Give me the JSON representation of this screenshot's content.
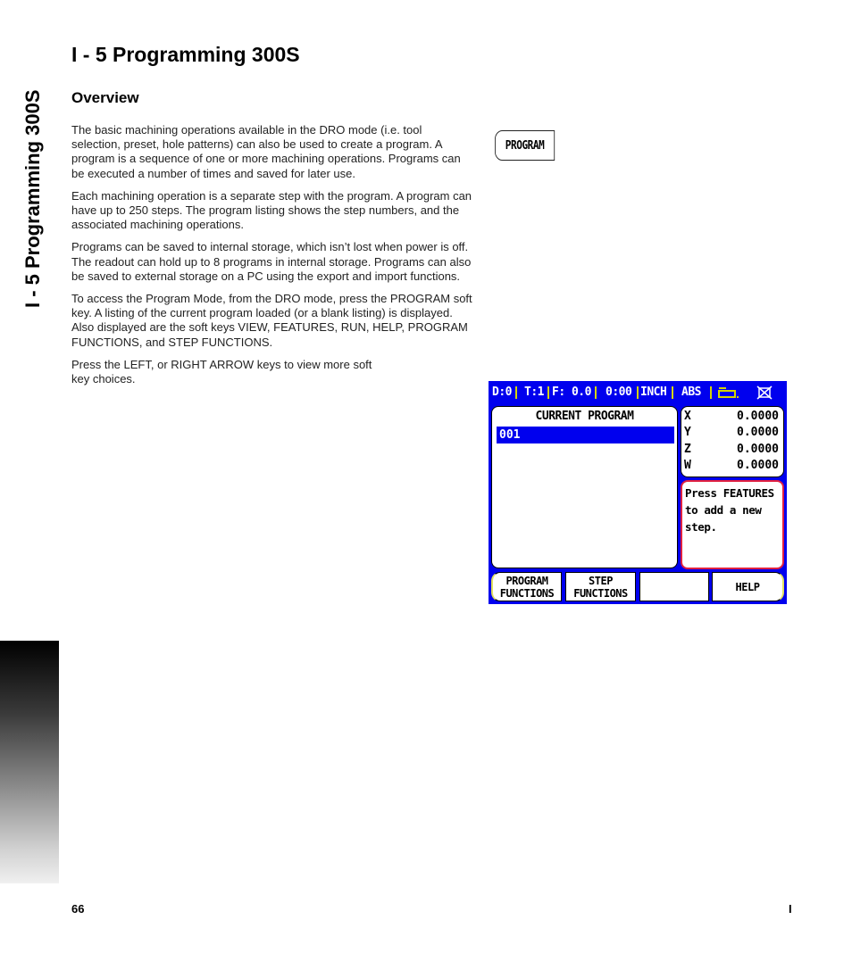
{
  "side_tab": {
    "label": "I - 5 Programming 300S"
  },
  "header": {
    "title": "I - 5 Programming 300S",
    "section": "Overview"
  },
  "body": {
    "paragraphs": [
      "The basic machining operations available in the DRO mode (i.e. tool selection, preset, hole patterns) can also be used to create a program. A program is a sequence of one or more machining operations. Programs can be executed a number of times and saved for later use.",
      "Each machining operation is a separate step with the program.  A program can have up to 250 steps.  The program listing shows the step numbers, and the associated machining operations.",
      "Programs can be saved to internal storage, which isn’t lost when power is off.  The readout can hold up to 8 programs in internal storage.  Programs can also be saved to external storage on a PC using the export and import functions.",
      "To access the Program Mode, from the DRO mode,  press the PROGRAM soft key.  A listing of the current program loaded (or a blank listing) is displayed.  Also displayed are the soft keys VIEW, FEATURES, RUN, HELP, PROGRAM FUNCTIONS, and STEP FUNCTIONS.",
      "Press the LEFT, or RIGHT ARROW keys to view more soft key choices."
    ]
  },
  "program_key": {
    "label": "PROGRAM"
  },
  "dro_screen": {
    "status_bar": {
      "datum": "D:0",
      "tool": "T:1",
      "feed": "F:  0.0",
      "timer": "0:00",
      "units": "INCH",
      "mode": "ABS",
      "icons": [
        "tool-holder-icon",
        "disabled-indicator-icon"
      ]
    },
    "program_panel": {
      "header": "CURRENT PROGRAM",
      "rows": [
        "001"
      ]
    },
    "axes": [
      {
        "axis": "X",
        "value": "0.0000"
      },
      {
        "axis": "Y",
        "value": "0.0000"
      },
      {
        "axis": "Z",
        "value": "0.0000"
      },
      {
        "axis": "W",
        "value": "0.0000"
      }
    ],
    "message": [
      "Press FEATURES",
      "to add a new",
      "step."
    ],
    "softkeys": [
      {
        "line1": "PROGRAM",
        "line2": "FUNCTIONS"
      },
      {
        "line1": "STEP",
        "line2": "FUNCTIONS"
      },
      {
        "line1": "",
        "line2": ""
      },
      {
        "line1": "HELP",
        "line2": ""
      }
    ],
    "colors": {
      "screen_bg": "#0000ee",
      "highlight": "#0000ee",
      "message_border": "#e02040",
      "separator": "#d4d400"
    }
  },
  "footer": {
    "page_number": "66",
    "chapter": "I"
  }
}
